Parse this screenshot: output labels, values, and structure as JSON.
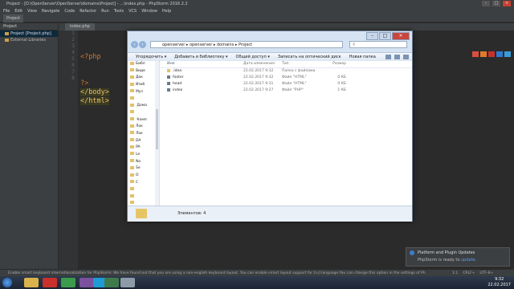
{
  "ide": {
    "title": "Project - [D:\\OpenServer\\OpenServer\\domains\\Project] - ...\\index.php - PhpStorm 2016.2.2",
    "menu": [
      "File",
      "Edit",
      "View",
      "Navigate",
      "Code",
      "Refactor",
      "Run",
      "Tools",
      "VCS",
      "Window",
      "Help"
    ],
    "nav_tab": "Project",
    "project_header": "Project",
    "tree": [
      {
        "label": "Project [Project.php]",
        "selected": true
      },
      {
        "label": "External Libraries",
        "selected": false
      }
    ],
    "editor_tab": "index.php",
    "line_numbers": [
      "1",
      "2",
      "3",
      "4",
      "5",
      "6",
      "7",
      "8"
    ],
    "code": {
      "php_open": "<?php",
      "php_close": "?>",
      "body_close": "</body>",
      "html_close": "</html>"
    },
    "status_message": "Enable smart keyboard internationalization for PhpStorm: We have found out that you are using a non-english keyboard layout. You can enable smart layout support for [ru] language.You can change this option in the settings of Php... (yesterday 22:20)",
    "status_right": [
      "1:1",
      "CRLF÷",
      "UTF-8÷"
    ]
  },
  "explorer": {
    "path": [
      "«pрограммы",
      "OpenServer",
      "domains",
      "Project"
    ],
    "path_text": "openserver ▸ openserver ▸ domains ▸ Project",
    "search_placeholder": "",
    "toolbar": [
      "Упорядочить ▾",
      "Добавить в библиотеку ▾",
      "Общий доступ ▾",
      "Записать на оптический диск",
      "Новая папка"
    ],
    "nav_items": [
      "Библ",
      "Виде",
      "Док",
      "Изоб",
      "Муз",
      "",
      " Дома",
      "",
      " Комп",
      "Лок",
      "Лок",
      "DA",
      "PA",
      "Le",
      "No",
      "Se",
      "O",
      "C",
      "",
      "",
      "",
      "",
      ""
    ],
    "columns": [
      "Имя",
      "Дата изменения",
      "Тип",
      "Размер"
    ],
    "files": [
      {
        "name": ".idea",
        "date": "22.02.2017 9:32",
        "type": "Папка с файлами",
        "size": "",
        "kind": "folder"
      },
      {
        "name": "footer",
        "date": "22.02.2017 9:32",
        "type": "Файл \"HTML\"",
        "size": "0 КБ",
        "kind": "file"
      },
      {
        "name": "head",
        "date": "22.02.2017 9:31",
        "type": "Файл \"HTML\"",
        "size": "0 КБ",
        "kind": "file"
      },
      {
        "name": "index",
        "date": "22.02.2017 9:27",
        "type": "Файл \"PHP\"",
        "size": "1 КБ",
        "kind": "file"
      }
    ],
    "status": "Элементов: 4"
  },
  "notification": {
    "title": "Platform and Plugin Updates",
    "body": "PhpStorm is ready to ",
    "link": "update."
  },
  "clock": {
    "time": "9:32",
    "date": "22.02.2017"
  },
  "colors": {
    "accent": "#3d7ec9",
    "ide_bg": "#2b2b2b"
  }
}
